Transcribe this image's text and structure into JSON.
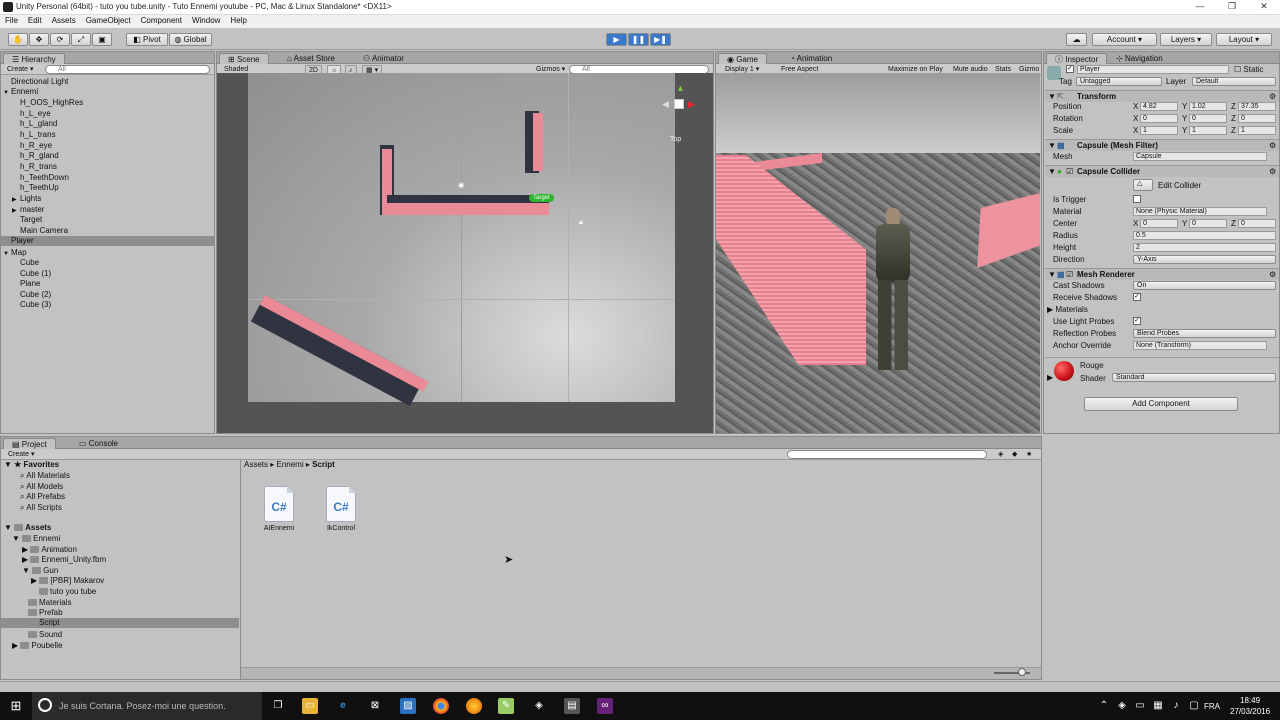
{
  "window": {
    "title": "Unity Personal (64bit) - tuto you tube.unity - Tuto Ennemi youtube - PC, Mac & Linux Standalone* <DX11>",
    "minimize": "—",
    "maximize": "❐",
    "close": "✕"
  },
  "menu": [
    "File",
    "Edit",
    "Assets",
    "GameObject",
    "Component",
    "Window",
    "Help"
  ],
  "toolbar": {
    "pivot": "Pivot",
    "global": "Global",
    "account": "Account",
    "layers": "Layers",
    "layout": "Layout"
  },
  "hierarchy": {
    "tab": "Hierarchy",
    "create": "Create",
    "search": "All",
    "items": [
      "Directional Light",
      "Ennemi",
      "H_OOS_HighRes",
      "h_L_eye",
      "h_L_gland",
      "h_L_trans",
      "h_R_eye",
      "h_R_gland",
      "h_R_trans",
      "h_TeethDown",
      "h_TeethUp",
      "Lights",
      "master",
      "Target",
      "Main Camera",
      "Player",
      "Map",
      "Cube",
      "Cube (1)",
      "Plane",
      "Cube (2)",
      "Cube (3)"
    ]
  },
  "scene": {
    "tabs": [
      "Scene",
      "Asset Store",
      "Animator"
    ],
    "shading": "Shaded",
    "mode2d": "2D",
    "gizmos": "Gizmos",
    "search": "All",
    "gizmo_label": "Top",
    "target_label": "Target"
  },
  "game": {
    "tabs": [
      "Game",
      "Animation"
    ],
    "display": "Display 1",
    "aspect": "Free Aspect",
    "buttons": [
      "Maximize on Play",
      "Mute audio",
      "Stats",
      "Gizmo"
    ]
  },
  "inspector": {
    "tabs": [
      "Inspector",
      "Navigation"
    ],
    "object_name": "Player",
    "static": "Static",
    "tag_label": "Tag",
    "tag": "Untagged",
    "layer_label": "Layer",
    "layer": "Default",
    "transform": {
      "title": "Transform",
      "position": "Position",
      "rotation": "Rotation",
      "scale": "Scale",
      "pos": [
        "4.82",
        "1.02",
        "37.35"
      ],
      "rot": [
        "0",
        "0",
        "0"
      ],
      "scl": [
        "1",
        "1",
        "1"
      ]
    },
    "axis": [
      "X",
      "Y",
      "Z"
    ],
    "mesh_filter": {
      "title": "Capsule (Mesh Filter)",
      "mesh_label": "Mesh",
      "mesh": "Capsule"
    },
    "collider": {
      "title": "Capsule Collider",
      "edit": "Edit Collider",
      "is_trigger": "Is Trigger",
      "material_label": "Material",
      "material": "None (Physic Material)",
      "center": "Center",
      "center_vals": [
        "0",
        "0",
        "0"
      ],
      "radius_label": "Radius",
      "radius": "0.5",
      "height_label": "Height",
      "height": "2",
      "direction_label": "Direction",
      "direction": "Y-Axis"
    },
    "renderer": {
      "title": "Mesh Renderer",
      "cast_shadows_label": "Cast Shadows",
      "cast_shadows": "On",
      "receive_shadows": "Receive Shadows",
      "materials": "Materials",
      "light_probes": "Use Light Probes",
      "reflection_label": "Reflection Probes",
      "reflection": "Blend Probes",
      "anchor_label": "Anchor Override",
      "anchor": "None (Transform)"
    },
    "material": {
      "name": "Rouge",
      "shader_label": "Shader",
      "shader": "Standard",
      "color": "#d0141c"
    },
    "add_component": "Add Component"
  },
  "project": {
    "tabs": [
      "Project",
      "Console"
    ],
    "create": "Create",
    "favorites_title": "Favorites",
    "favorites": [
      "All Materials",
      "All Models",
      "All Prefabs",
      "All Scripts"
    ],
    "assets_title": "Assets",
    "tree": [
      "Ennemi",
      "Animation",
      "Ennemi_Unity.fbm",
      "Gun",
      "[PBR] Makarov",
      "tuto you tube",
      "Materials",
      "Prefab",
      "Script",
      "Sound",
      "Poubelle"
    ],
    "breadcrumb": [
      "Assets",
      "Ennemi",
      "Script"
    ],
    "files": [
      {
        "name": "AIEnnemi",
        "glyph": "C#"
      },
      {
        "name": "IkControl",
        "glyph": "C#"
      }
    ]
  },
  "taskbar": {
    "search": "Je suis Cortana. Posez-moi une question.",
    "lang": "FRA",
    "time": "18:49",
    "date": "27/03/2016"
  },
  "colors": {
    "wall": "#e98a96",
    "accent": "#3b78c9"
  }
}
